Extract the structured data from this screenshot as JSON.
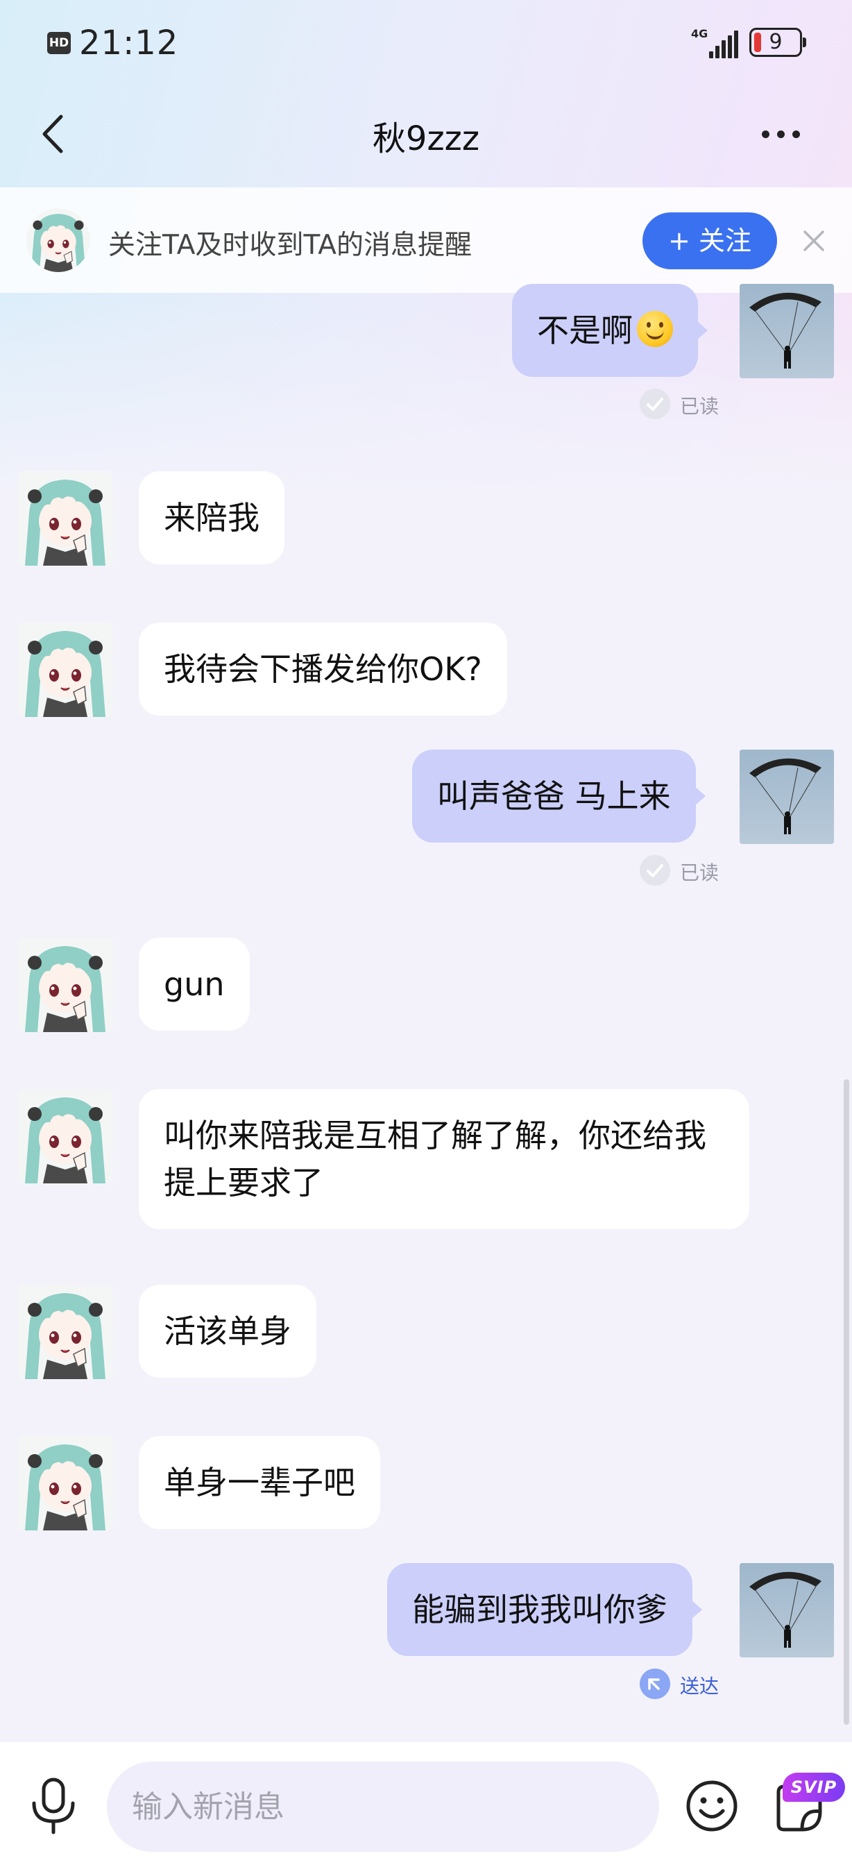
{
  "status_bar": {
    "hd": "HD",
    "time": "21:12",
    "network": "4G",
    "battery": "9"
  },
  "header": {
    "title": "秋9zzz"
  },
  "follow_banner": {
    "text": "关注TA及时收到TA的消息提醒",
    "button_label": "+ 关注"
  },
  "messages": [
    {
      "side": "right",
      "text": "不是啊",
      "emoji": "smiling-face",
      "receipt": "已读"
    },
    {
      "side": "left",
      "text": "来陪我"
    },
    {
      "side": "left",
      "text": "我待会下播发给你OK?"
    },
    {
      "side": "right",
      "text": "叫声爸爸 马上来",
      "receipt": "已读"
    },
    {
      "side": "left",
      "text": "gun"
    },
    {
      "side": "left",
      "text": "叫你来陪我是互相了解了解，你还给我提上要求了"
    },
    {
      "side": "left",
      "text": "活该单身"
    },
    {
      "side": "left",
      "text": "单身一辈子吧"
    },
    {
      "side": "right",
      "text": "能骗到我我叫你爹",
      "receipt": "送达"
    }
  ],
  "input_bar": {
    "placeholder": "输入新消息",
    "svip_badge": "SVIP"
  },
  "colors": {
    "accent": "#3a71f0",
    "outgoing_bubble": "#cbcffa",
    "incoming_bubble": "#ffffff",
    "background": "#f3f2fb"
  }
}
